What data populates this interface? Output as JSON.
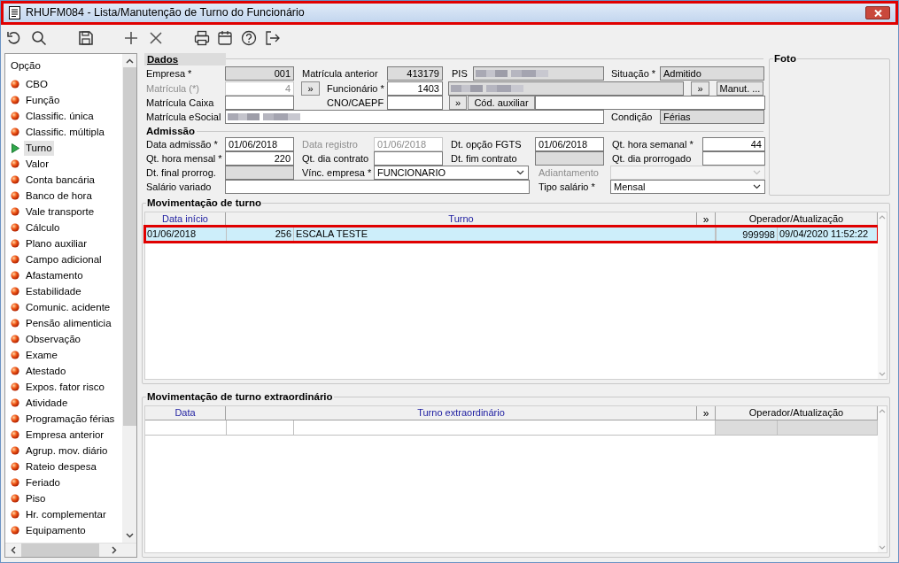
{
  "window": {
    "title": "RHUFM084 - Lista/Manutenção de Turno do Funcionário",
    "outlined": true
  },
  "sidebar": {
    "heading": "Opção",
    "items": [
      {
        "label": "CBO",
        "selected": false
      },
      {
        "label": "Função",
        "selected": false
      },
      {
        "label": "Classific. única",
        "selected": false
      },
      {
        "label": "Classific. múltipla",
        "selected": false
      },
      {
        "label": "Turno",
        "selected": true
      },
      {
        "label": "Valor",
        "selected": false
      },
      {
        "label": "Conta bancária",
        "selected": false
      },
      {
        "label": "Banco de hora",
        "selected": false
      },
      {
        "label": "Vale transporte",
        "selected": false
      },
      {
        "label": "Cálculo",
        "selected": false
      },
      {
        "label": "Plano auxiliar",
        "selected": false
      },
      {
        "label": "Campo adicional",
        "selected": false
      },
      {
        "label": "Afastamento",
        "selected": false
      },
      {
        "label": "Estabilidade",
        "selected": false
      },
      {
        "label": "Comunic. acidente",
        "selected": false
      },
      {
        "label": "Pensão alimenticia",
        "selected": false
      },
      {
        "label": "Observação",
        "selected": false
      },
      {
        "label": "Exame",
        "selected": false
      },
      {
        "label": "Atestado",
        "selected": false
      },
      {
        "label": "Expos. fator risco",
        "selected": false
      },
      {
        "label": "Atividade",
        "selected": false
      },
      {
        "label": "Programação férias",
        "selected": false
      },
      {
        "label": "Empresa anterior",
        "selected": false
      },
      {
        "label": "Agrup. mov. diário",
        "selected": false
      },
      {
        "label": "Rateio despesa",
        "selected": false
      },
      {
        "label": "Feriado",
        "selected": false
      },
      {
        "label": "Piso",
        "selected": false
      },
      {
        "label": "Hr. complementar",
        "selected": false
      },
      {
        "label": "Equipamento",
        "selected": false
      }
    ]
  },
  "dados": {
    "title": "Dados",
    "controls": [
      {
        "kind": "label",
        "text": "Empresa *",
        "disabled": false
      },
      {
        "kind": "field",
        "value": "001",
        "readonly": true,
        "disabled": false,
        "right_aligned": true
      },
      {
        "kind": "label",
        "text": "Matrícula anterior",
        "disabled": false
      },
      {
        "kind": "field",
        "value": "413179",
        "readonly": true,
        "disabled": false,
        "right_aligned": true
      },
      {
        "kind": "label",
        "text": "PIS",
        "disabled": false
      },
      {
        "kind": "masked",
        "readonly": true
      },
      {
        "kind": "label",
        "text": "Situação *",
        "disabled": false
      },
      {
        "kind": "field",
        "value": "Admitido",
        "readonly": true,
        "disabled": false,
        "right_aligned": false
      },
      {
        "kind": "label",
        "text": "Matrícula (*)",
        "disabled": true
      },
      {
        "kind": "field",
        "value": "4",
        "readonly": false,
        "disabled": true,
        "right_aligned": true
      },
      {
        "kind": "button",
        "text": "»"
      },
      {
        "kind": "label",
        "text": "Funcionário *",
        "disabled": false
      },
      {
        "kind": "field",
        "value": "1403",
        "readonly": false,
        "disabled": false,
        "right_aligned": true
      },
      {
        "kind": "masked",
        "readonly": true
      },
      {
        "kind": "button",
        "text": "»"
      },
      {
        "kind": "button",
        "text": "Manut. ..."
      },
      {
        "kind": "label",
        "text": "Matrícula Caixa",
        "disabled": false
      },
      {
        "kind": "field",
        "readonly": false,
        "disabled": false
      },
      {
        "kind": "label",
        "text": "CNO/CAEPF",
        "disabled": false
      },
      {
        "kind": "field",
        "readonly": false,
        "disabled": false
      },
      {
        "kind": "button",
        "text": "»"
      },
      {
        "kind": "button",
        "text": "Cód. auxiliar"
      },
      {
        "kind": "field",
        "readonly": false,
        "disabled": false
      },
      {
        "kind": "label",
        "text": "Matrícula eSocial",
        "disabled": false
      },
      {
        "kind": "masked",
        "readonly": false
      },
      {
        "kind": "label",
        "text": "Condição",
        "disabled": false
      },
      {
        "kind": "field",
        "value": "Férias",
        "readonly": true,
        "disabled": false,
        "right_aligned": false
      }
    ]
  },
  "admissao": {
    "title": "Admissão",
    "controls": [
      {
        "kind": "label",
        "text": "Data admissão *",
        "disabled": false
      },
      {
        "kind": "field",
        "value": "01/06/2018",
        "readonly": false,
        "disabled": false,
        "right_aligned": false
      },
      {
        "kind": "label",
        "text": "Data registro",
        "disabled": true
      },
      {
        "kind": "field",
        "value": "01/06/2018",
        "readonly": false,
        "disabled": true,
        "right_aligned": false
      },
      {
        "kind": "label",
        "text": "Dt. opção FGTS",
        "disabled": false
      },
      {
        "kind": "field",
        "value": "01/06/2018",
        "readonly": false,
        "disabled": false,
        "right_aligned": false
      },
      {
        "kind": "label",
        "text": "Qt. hora semanal *",
        "disabled": false
      },
      {
        "kind": "field",
        "value": "44",
        "readonly": false,
        "disabled": false,
        "right_aligned": true
      },
      {
        "kind": "label",
        "text": "Qt. hora mensal *",
        "disabled": false
      },
      {
        "kind": "field",
        "value": "220",
        "readonly": false,
        "disabled": false,
        "right_aligned": true
      },
      {
        "kind": "label",
        "text": "Qt. dia contrato",
        "disabled": false
      },
      {
        "kind": "field",
        "readonly": false,
        "disabled": false
      },
      {
        "kind": "label",
        "text": "Dt. fim contrato",
        "disabled": false
      },
      {
        "kind": "field",
        "readonly": true,
        "disabled": false
      },
      {
        "kind": "label",
        "text": "Qt. dia prorrogado",
        "disabled": false
      },
      {
        "kind": "field",
        "readonly": false,
        "disabled": false
      },
      {
        "kind": "label",
        "text": "Dt. final prorrog.",
        "disabled": false
      },
      {
        "kind": "field",
        "readonly": true,
        "disabled": false
      },
      {
        "kind": "label",
        "text": "Vínc. empresa *",
        "disabled": false
      },
      {
        "kind": "dropdown",
        "value": "FUNCIONARIO",
        "disabled": false
      },
      {
        "kind": "label",
        "text": "Adiantamento",
        "disabled": true
      },
      {
        "kind": "dropdown",
        "disabled": true
      },
      {
        "kind": "label",
        "text": "Salário variado",
        "disabled": false
      },
      {
        "kind": "field",
        "readonly": false,
        "disabled": false
      },
      {
        "kind": "label",
        "text": "Tipo salário *",
        "disabled": false
      },
      {
        "kind": "dropdown",
        "value": "Mensal",
        "disabled": false
      }
    ]
  },
  "foto": {
    "title": "Foto"
  },
  "grids": [
    {
      "title": "Movimentação de turno",
      "columns": [
        "Data início",
        "Turno"
      ],
      "expand_button": "»",
      "operator_column": "Operador/Atualização",
      "rows": [
        {
          "cells": [
            "01/06/2018",
            "256",
            "ESCALA TESTE",
            "999998",
            "09/04/2020 11:52:22"
          ],
          "selected": true,
          "outlined": true
        }
      ]
    },
    {
      "title": "Movimentação de turno extraordinário",
      "columns": [
        "Data",
        "Turno extraordinário"
      ],
      "expand_button": "»",
      "operator_column": "Operador/Atualização",
      "rows": [
        {
          "cells": [],
          "selected": false,
          "outlined": false
        }
      ]
    }
  ]
}
